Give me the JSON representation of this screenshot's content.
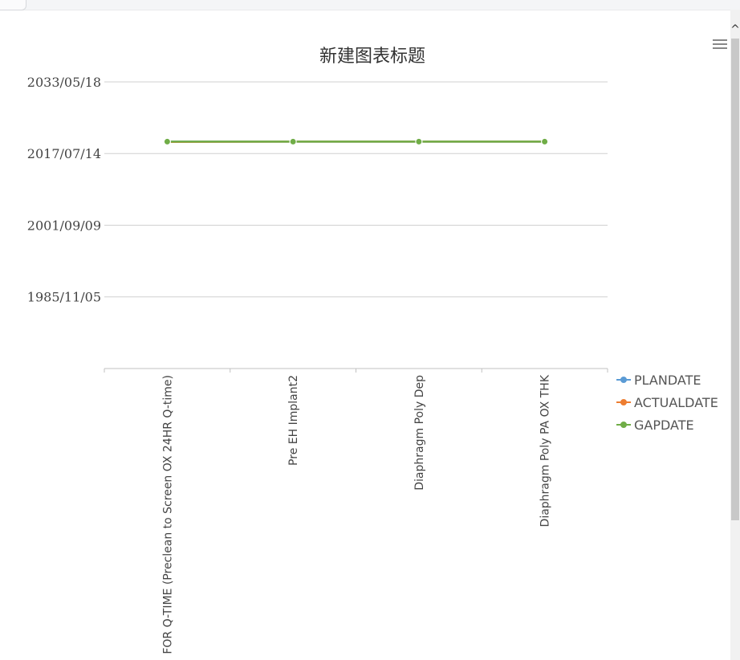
{
  "chart_menu": {
    "icon": "hamburger-menu-icon"
  },
  "scroll": {
    "up_icon": "chevron-up-icon",
    "up_glyph": "^"
  },
  "chart_data": {
    "type": "line",
    "title": "新建图表标题",
    "xlabel": "",
    "ylabel": "",
    "categories": [
      "FOR Q-TIME (Preclean to Screen OX 24HR Q-time)",
      "Pre EH Implant2",
      "Diaphragm Poly Dep",
      "Diaphragm Poly PA OX THK"
    ],
    "y_ticks": [
      "2033/05/18",
      "2017/07/14",
      "2001/09/09",
      "1985/11/05"
    ],
    "y_axis_type": "date",
    "ylim": [
      "1969/12/31",
      "2033/05/18"
    ],
    "grid": true,
    "legend_position": "right",
    "series": [
      {
        "name": "PLANDATE",
        "color": "#5b9bd5",
        "values": [
          "2020/03/01",
          "2020/03/01",
          "2020/03/01",
          "2020/03/01"
        ]
      },
      {
        "name": "ACTUALDATE",
        "color": "#ed7d31",
        "values": [
          "2020/02/10",
          "2020/03/01",
          "2020/03/01",
          "2020/03/01"
        ]
      },
      {
        "name": "GAPDATE",
        "color": "#70ad47",
        "values": [
          "2020/03/01",
          "2020/03/01",
          "2020/03/01",
          "2020/03/01"
        ]
      }
    ]
  }
}
